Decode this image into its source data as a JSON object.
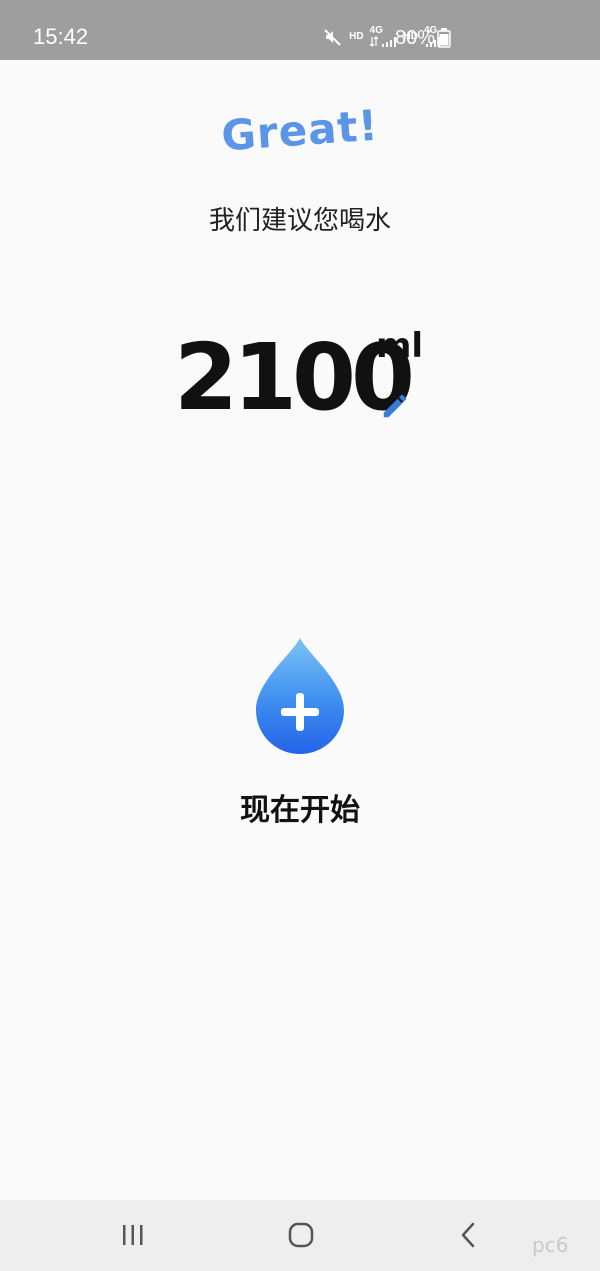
{
  "status_bar": {
    "time": "15:42",
    "label_hd_1": "HD",
    "label_4g_1": "4G",
    "label_hd_2": "HD",
    "label_4g_2": "4G",
    "battery": "80%",
    "icons": [
      "mute-icon",
      "signal-icon",
      "signal-icon",
      "battery-icon"
    ]
  },
  "main": {
    "title": "Great!",
    "suggestion": "我们建议您喝水",
    "amount": "2100",
    "unit": "ml",
    "start_label": "现在开始",
    "icons": [
      "edit-icon",
      "water-drop-add-icon"
    ]
  },
  "nav_bar": {
    "icons": [
      "recent-apps-icon",
      "home-icon",
      "back-icon"
    ]
  },
  "watermark": {
    "text": "pc6"
  },
  "colors": {
    "accent_blue": "#5b95e8",
    "drop_top": "#7cc3f5",
    "drop_bottom": "#2563e8",
    "status_bar": "#9e9e9e",
    "nav_bar": "#eeeeee"
  }
}
